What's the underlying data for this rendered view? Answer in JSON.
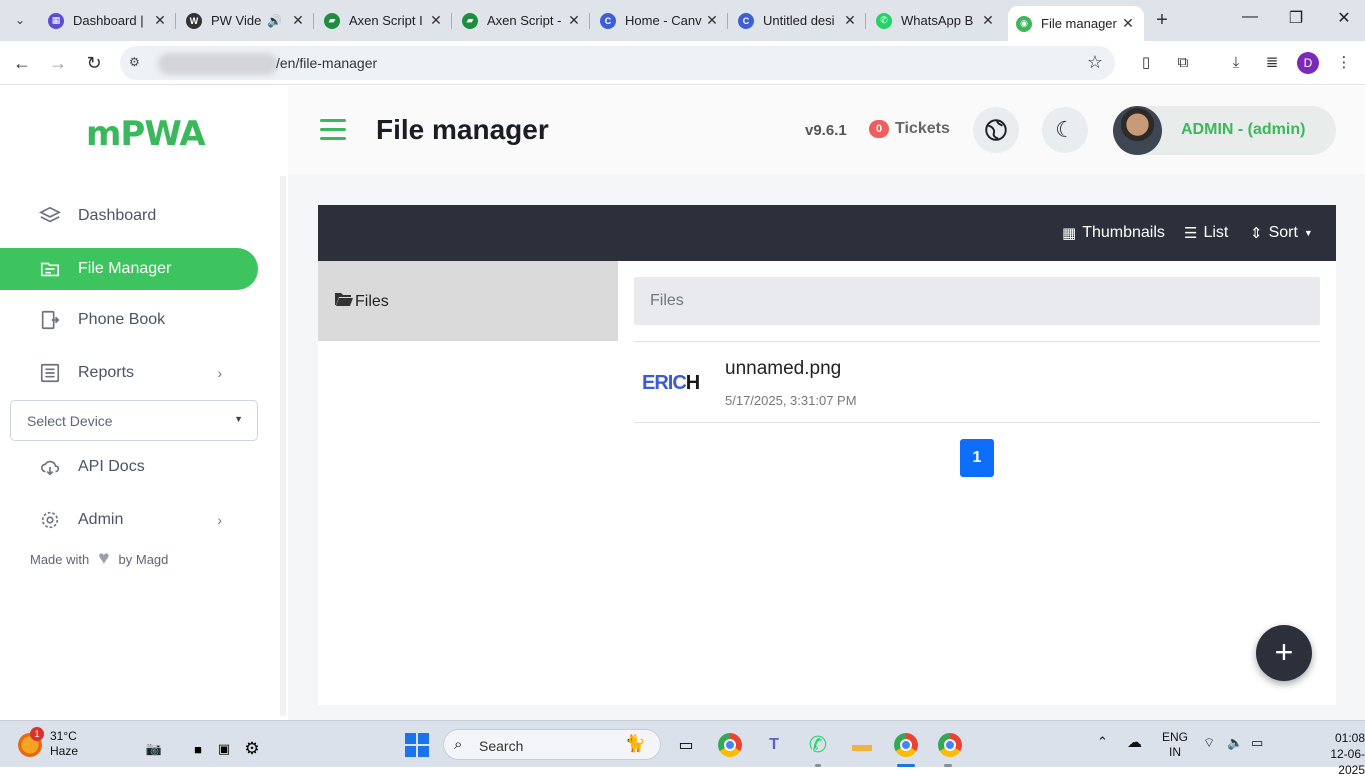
{
  "browser": {
    "tabs": [
      {
        "title": "Dashboard |",
        "color": "#5b4bd6",
        "glyph": "▦"
      },
      {
        "title": "PW Vide",
        "color": "#333",
        "glyph": "W"
      },
      {
        "title": "Axen Script I",
        "color": "#1e8e3e",
        "glyph": "▰"
      },
      {
        "title": "Axen Script -",
        "color": "#1e8e3e",
        "glyph": "▰"
      },
      {
        "title": "Home - Canv",
        "color": "#3d5fd6",
        "glyph": "C"
      },
      {
        "title": "Untitled desi",
        "color": "#3d5fd6",
        "glyph": "C"
      },
      {
        "title": "WhatsApp B",
        "color": "#25d366",
        "glyph": "✆"
      },
      {
        "title": "File manager",
        "color": "#3cb85c",
        "glyph": "◉"
      }
    ],
    "close_glyph": "✕",
    "new_tab_glyph": "+",
    "url": "/en/file-manager",
    "profile_letter": "D"
  },
  "app": {
    "logo_text": "mPWA",
    "sidebar": {
      "items": [
        {
          "label": "Dashboard",
          "icon": "layers-icon"
        },
        {
          "label": "File Manager",
          "icon": "folder-icon"
        },
        {
          "label": "Phone Book",
          "icon": "phone-book-icon"
        },
        {
          "label": "Reports",
          "icon": "reports-icon"
        },
        {
          "label": "API Docs",
          "icon": "cloud-download-icon"
        },
        {
          "label": "Admin",
          "icon": "gear-icon"
        }
      ],
      "select_device_placeholder": "Select Device",
      "made_with": "Made with",
      "by": "by Magd"
    },
    "header": {
      "title": "File manager",
      "version": "v9.6.1",
      "tickets_count": "0",
      "tickets_label": "Tickets",
      "user_label": "ADMIN - (admin)"
    },
    "file_manager": {
      "views": {
        "thumbnails": "Thumbnails",
        "list": "List",
        "sort": "Sort"
      },
      "tree_root": "Files",
      "breadcrumb": "Files",
      "files": [
        {
          "name": "unnamed.png",
          "date": "5/17/2025, 3:31:07 PM",
          "thumb_text_a": "ERIC",
          "thumb_text_b": "H"
        }
      ],
      "pagination": [
        "1"
      ],
      "fab_label": "+"
    }
  },
  "taskbar": {
    "temp": "31°C",
    "weather": "Haze",
    "notification_count": "1",
    "search_label": "Search",
    "lang_top": "ENG",
    "lang_bottom": "IN",
    "time": "01:08",
    "date": "12-06-2025"
  },
  "colors": {
    "accent": "#3dc45e",
    "dark": "#2b303b",
    "page_btn": "#0d6efd",
    "tickets_badge": "#f05d5d"
  }
}
